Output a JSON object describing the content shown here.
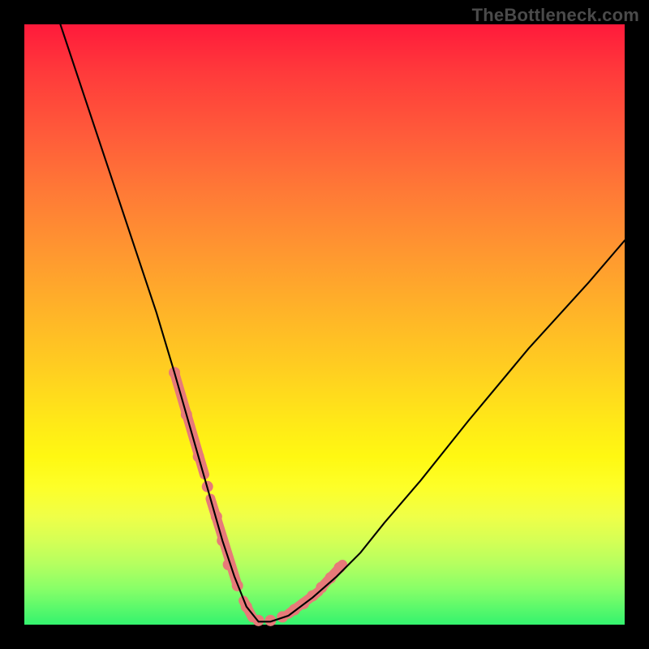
{
  "watermark": {
    "text": "TheBottleneck.com"
  },
  "chart_data": {
    "type": "line",
    "title": "",
    "xlabel": "",
    "ylabel": "",
    "xlim": [
      0,
      100
    ],
    "ylim": [
      0,
      100
    ],
    "grid": false,
    "legend": null,
    "series": [
      {
        "name": "curve",
        "stroke": "#000000",
        "stroke_width": 2.1,
        "x": [
          6,
          10,
          14,
          18,
          22,
          25,
          27,
          29,
          31,
          33,
          35,
          37,
          39,
          41,
          44,
          48,
          52,
          56,
          60,
          66,
          74,
          84,
          94,
          100
        ],
        "values": [
          100,
          88,
          76,
          64,
          52,
          42,
          35,
          28,
          21,
          14,
          8,
          3,
          0.5,
          0.5,
          1.5,
          4.5,
          8,
          12,
          17,
          24,
          34,
          46,
          57,
          64
        ]
      },
      {
        "name": "overlay-dots",
        "color": "#e77a79",
        "marker_radius": 7,
        "x": [
          25,
          27,
          29,
          30.5,
          32,
          33,
          34,
          35.5,
          37,
          39,
          41,
          43,
          45,
          46.5,
          48,
          49.5,
          51,
          52.5
        ],
        "values": [
          42,
          35,
          28,
          23,
          18,
          14,
          10,
          6.5,
          3,
          0.7,
          0.7,
          1.3,
          2.5,
          3.5,
          4.8,
          6.2,
          7.8,
          9.5
        ]
      },
      {
        "name": "overlay-segments",
        "color": "#e77a79",
        "stroke_width": 12,
        "segments": [
          {
            "x": [
              25,
              30
            ],
            "values": [
              42,
              25
            ]
          },
          {
            "x": [
              31,
              35.5
            ],
            "values": [
              21,
              6.5
            ]
          },
          {
            "x": [
              36.5,
              38
            ],
            "values": [
              4,
              1.2
            ]
          },
          {
            "x": [
              44,
              49
            ],
            "values": [
              1.8,
              5.5
            ]
          },
          {
            "x": [
              49.5,
              53
            ],
            "values": [
              6.2,
              10
            ]
          }
        ]
      }
    ]
  }
}
